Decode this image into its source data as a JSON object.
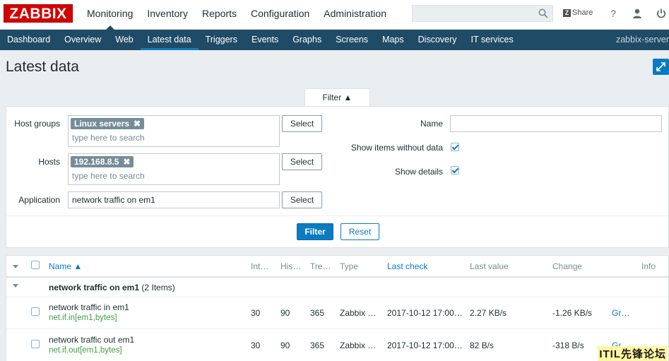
{
  "header": {
    "logo": "ZABBIX",
    "menu": [
      "Monitoring",
      "Inventory",
      "Reports",
      "Configuration",
      "Administration"
    ],
    "search_placeholder": "",
    "share_label": "Share",
    "help_icon": "?",
    "user_icon": "user-icon",
    "logout_icon": "power-icon"
  },
  "subnav": {
    "items": [
      "Dashboard",
      "Overview",
      "Web",
      "Latest data",
      "Triggers",
      "Events",
      "Graphs",
      "Screens",
      "Maps",
      "Discovery",
      "IT services"
    ],
    "active": "Latest data",
    "server_name": "zabbix-server"
  },
  "page": {
    "title": "Latest data"
  },
  "filter": {
    "tab_label": "Filter ▲",
    "host_groups_label": "Host groups",
    "host_groups_tag": "Linux servers",
    "hosts_label": "Hosts",
    "hosts_tag": "192.168.8.5",
    "search_placeholder": "type here to search",
    "application_label": "Application",
    "application_value": "network traffic on em1",
    "select_label": "Select",
    "name_label": "Name",
    "name_value": "",
    "show_without_data_label": "Show items without data",
    "show_without_data": true,
    "show_details_label": "Show details",
    "show_details": true,
    "filter_button": "Filter",
    "reset_button": "Reset"
  },
  "table": {
    "headers": {
      "name": "Name ▲",
      "interval": "Int…",
      "history": "His…",
      "trends": "Tre…",
      "type": "Type",
      "last_check": "Last check",
      "last_value": "Last value",
      "change": "Change",
      "info": "Info"
    },
    "group": {
      "name": "network traffic on em1",
      "count": "(2 Items)"
    },
    "rows": [
      {
        "name": "network traffic in em1",
        "key": "net.if.in[em1,bytes]",
        "interval": "30",
        "history": "90",
        "trends": "365",
        "type": "Zabbix …",
        "last_check": "2017-10-12 17:00…",
        "last_value": "2.27 KB/s",
        "change": "-1.26 KB/s",
        "action": "Gr…"
      },
      {
        "name": "network traffic out em1",
        "key": "net.if.out[em1,bytes]",
        "interval": "30",
        "history": "90",
        "trends": "365",
        "type": "Zabbix …",
        "last_check": "2017-10-12 17:00…",
        "last_value": "82 B/s",
        "change": "-318 B/s",
        "action": "Gr…"
      }
    ]
  },
  "watermark": "ITIL先锋论坛",
  "colors": {
    "brand": "#d40000",
    "nav": "#1f4b66",
    "accent": "#0b7bc1",
    "key_green": "#429e47"
  }
}
